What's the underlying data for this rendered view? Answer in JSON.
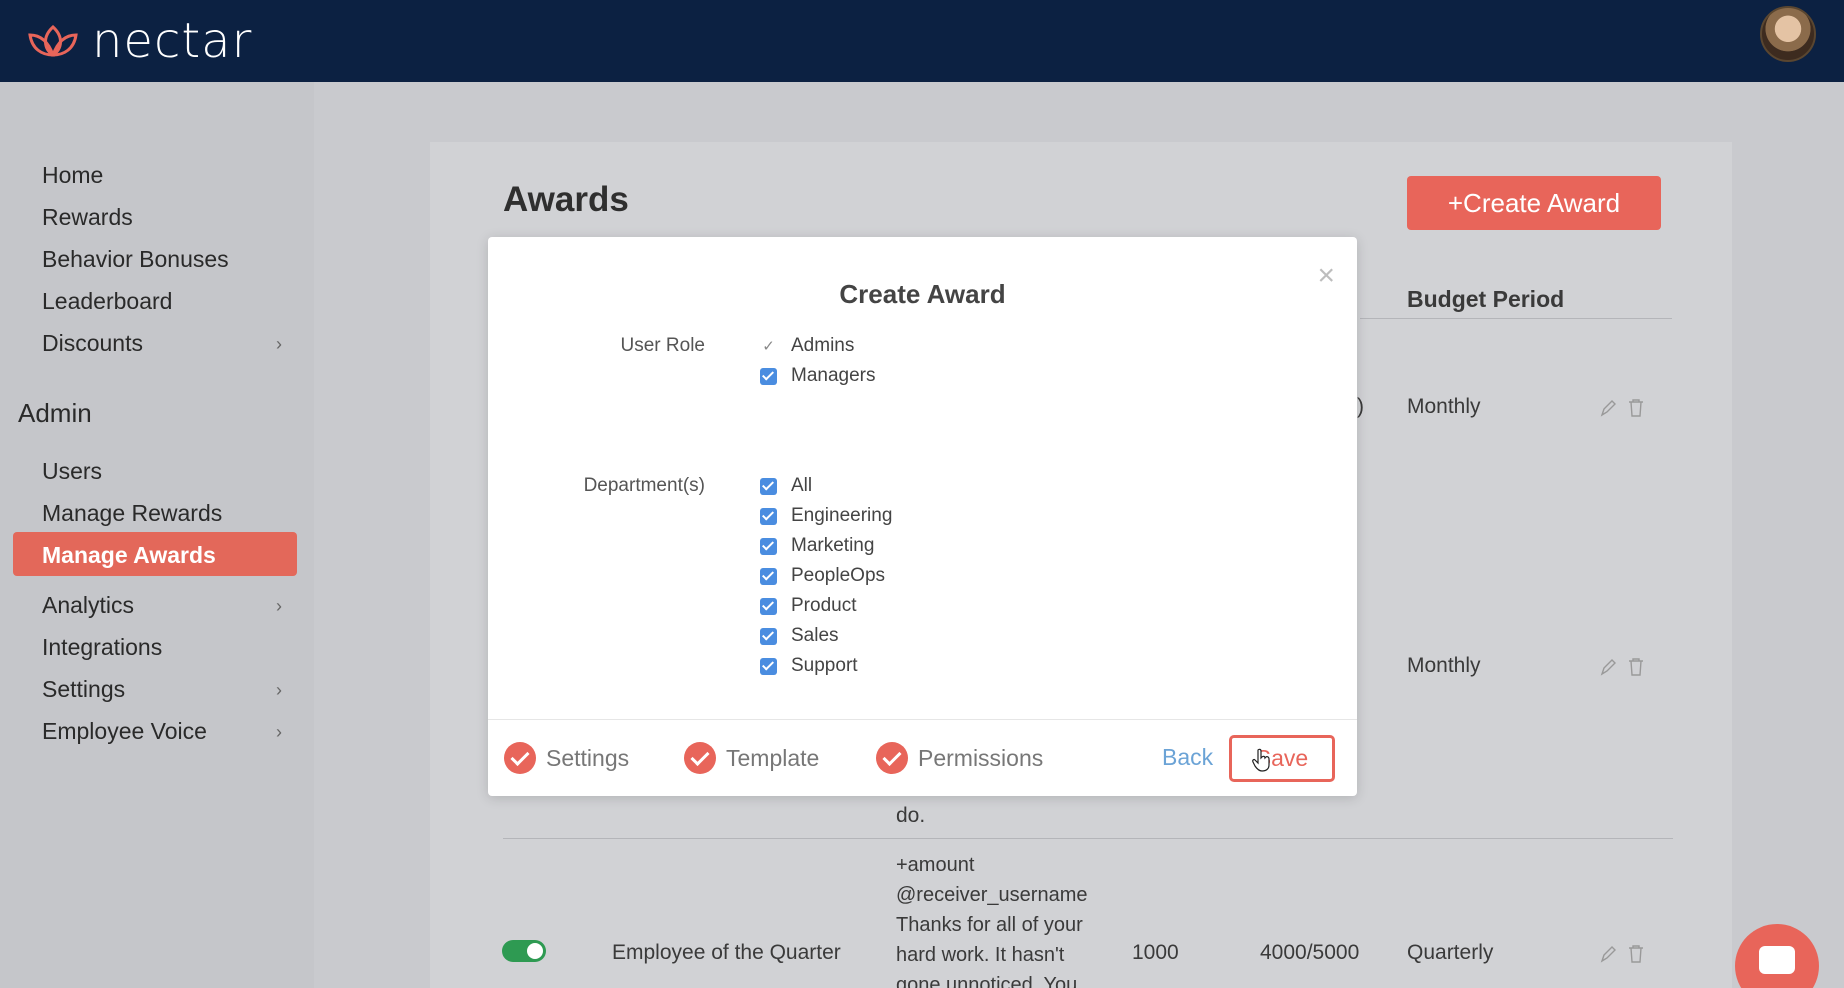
{
  "app": {
    "brand": "nectar"
  },
  "sidebar": {
    "items": [
      {
        "label": "Home"
      },
      {
        "label": "Rewards"
      },
      {
        "label": "Behavior Bonuses"
      },
      {
        "label": "Leaderboard"
      },
      {
        "label": "Discounts",
        "has_chevron": true
      }
    ],
    "admin_section": "Admin",
    "admin_items": [
      {
        "label": "Users"
      },
      {
        "label": "Manage Rewards"
      },
      {
        "label": "Manage Awards",
        "active": true
      },
      {
        "label": "Analytics",
        "has_chevron": true
      },
      {
        "label": "Integrations"
      },
      {
        "label": "Settings",
        "has_chevron": true
      },
      {
        "label": "Employee Voice",
        "has_chevron": true
      }
    ],
    "active_color": "#e3685a"
  },
  "main": {
    "title": "Awards",
    "create_button": "+Create Award",
    "column_budget_period": "Budget Period",
    "rows": [
      {
        "budget_period": "Monthly"
      },
      {
        "budget_period": "Monthly"
      },
      {
        "name": "Employee of the Quarter",
        "amount": "1000",
        "budget": "4000/5000",
        "budget_period": "Quarterly",
        "enabled": true,
        "message_lines": [
          "+amount",
          "@receiver_username",
          "Thanks for all of your",
          "hard work. It hasn't",
          "gone unnoticed. You"
        ]
      }
    ],
    "fragment_text": "do.",
    "partial_cell_char": ")"
  },
  "modal": {
    "title": "Create Award",
    "close_symbol": "×",
    "user_role_label": "User Role",
    "user_roles": [
      {
        "label": "Admins",
        "checked": false,
        "mark": "✓"
      },
      {
        "label": "Managers",
        "checked": true
      }
    ],
    "department_label": "Department(s)",
    "departments": [
      {
        "label": "All",
        "checked": true
      },
      {
        "label": "Engineering",
        "checked": true
      },
      {
        "label": "Marketing",
        "checked": true
      },
      {
        "label": "PeopleOps",
        "checked": true
      },
      {
        "label": "Product",
        "checked": true
      },
      {
        "label": "Sales",
        "checked": true
      },
      {
        "label": "Support",
        "checked": true
      }
    ],
    "steps": [
      {
        "label": "Settings",
        "done": true
      },
      {
        "label": "Template",
        "done": true
      },
      {
        "label": "Permissions",
        "done": true
      }
    ],
    "back_label": "Back",
    "save_label": "Save"
  },
  "colors": {
    "topbar": "#0c2142",
    "accent": "#e8655a",
    "checkbox": "#4a8de0",
    "link": "#6ba3d6",
    "toggle_on": "#2e9a52"
  }
}
